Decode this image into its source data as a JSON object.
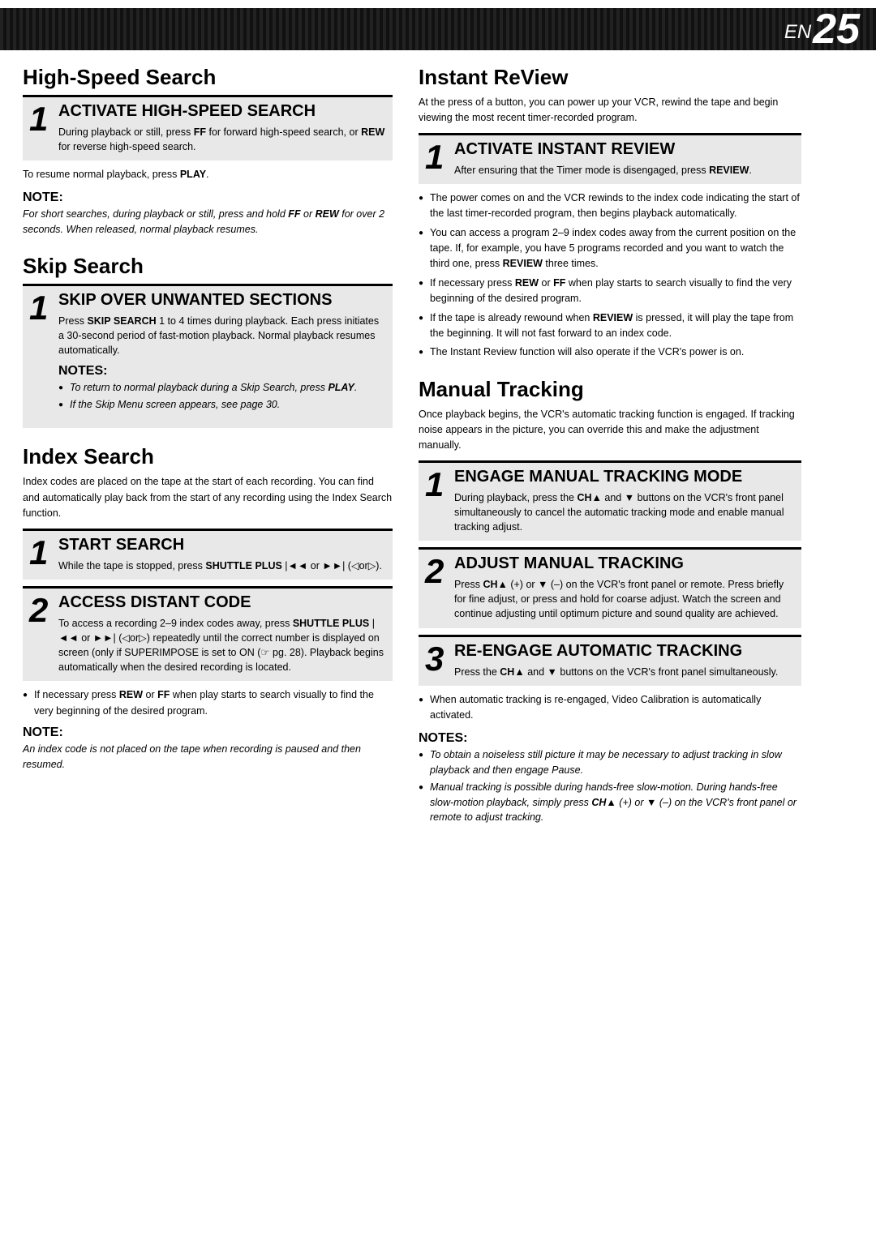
{
  "page": {
    "en_label": "EN",
    "page_number": "25"
  },
  "sections": {
    "high_speed_search": {
      "title": "High-Speed Search",
      "step1": {
        "header": "ACTIVATE HIGH-SPEED SEARCH",
        "body": "During playback or still, press <b>FF</b> for forward high-speed search, or <b>REW</b> for reverse high-speed search."
      },
      "resume": "To resume normal playback, press <b>PLAY</b>.",
      "note": {
        "title": "NOTE:",
        "body": "For short searches, during playback or still, press and hold <b>FF</b> or <b>REW</b> for over 2 seconds. When released, normal playback resumes."
      }
    },
    "skip_search": {
      "title": "Skip Search",
      "step1": {
        "header": "SKIP OVER UNWANTED SECTIONS",
        "body": "Press <b>SKIP SEARCH</b> 1 to 4 times during playback. Each press initiates a 30-second period of fast-motion playback. Normal playback resumes automatically."
      },
      "notes": {
        "title": "NOTES:",
        "items": [
          "To return to normal playback during a Skip Search, press <b>PLAY</b>.",
          "If the Skip Menu screen appears, see page 30."
        ]
      }
    },
    "index_search": {
      "title": "Index Search",
      "intro": "Index codes are placed on the tape at the start of each recording. You can find and automatically play back from the start of any recording using the Index Search function.",
      "step1": {
        "header": "START SEARCH",
        "body": "While the tape is stopped, press <b>SHUTTLE PLUS</b> |◄◄ or ►►| (◁or▷)."
      },
      "step2": {
        "header": "ACCESS DISTANT CODE",
        "body": "To access a recording 2–9 index codes away, press <b>SHUTTLE PLUS</b> |◄◄ or ►►| (◁or▷) repeatedly until the correct number is displayed on screen (only if SUPERIMPOSE is set to ON (☞ pg. 28). Playback begins automatically when the desired recording is located."
      },
      "note_bottom": {
        "title": "NOTE:",
        "body": "An index code is not placed on the tape when recording is paused and then resumed."
      },
      "bullet": "If necessary press <b>REW</b> or <b>FF</b> when play starts to search visually to find the very beginning of the desired program."
    },
    "instant_review": {
      "title": "Instant ReView",
      "intro": "At the press of a button, you can power up your VCR, rewind the tape and begin viewing the most recent timer-recorded program.",
      "step1": {
        "header": "ACTIVATE INSTANT REVIEW",
        "body": "After ensuring that the Timer mode is disengaged, press <b>REVIEW</b>."
      },
      "bullets": [
        "The power comes on and the VCR rewinds to the index code indicating the start of the last timer-recorded program, then begins playback automatically.",
        "You can access a program 2–9 index codes away from the current position on the tape. If, for example, you have 5 programs recorded and you want to watch the third one, press <b>REVIEW</b> three times.",
        "If necessary press <b>REW</b> or <b>FF</b> when play starts to search visually to find the very beginning of the desired program.",
        "If the tape is already rewound when <b>REVIEW</b> is pressed, it will play the tape from the beginning. It will not fast forward to an index code.",
        "The Instant Review function will also operate if the VCR's power is on."
      ]
    },
    "manual_tracking": {
      "title": "Manual Tracking",
      "intro": "Once playback begins, the VCR's automatic tracking function is engaged. If tracking noise appears in the picture, you can override this and make the adjustment manually.",
      "step1": {
        "header": "ENGAGE MANUAL TRACKING MODE",
        "body": "During playback, press the <b>CH▲</b> and <b>▼</b> buttons on the VCR's front panel simultaneously to cancel the automatic tracking mode and enable manual tracking adjust."
      },
      "step2": {
        "header": "ADJUST MANUAL TRACKING",
        "body": "Press <b>CH▲</b> (+) or <b>▼</b> (–) on the VCR's front panel or remote. Press briefly for fine adjust, or press and hold for coarse adjust. Watch the screen and continue adjusting until optimum picture and sound quality are achieved."
      },
      "step3": {
        "header": "RE-ENGAGE AUTOMATIC TRACKING",
        "body": "Press the <b>CH▲</b> and <b>▼</b> buttons on the VCR's front panel simultaneously."
      },
      "bullet_after_step3": "When automatic tracking is re-engaged, Video Calibration is automatically activated.",
      "notes": {
        "title": "NOTES:",
        "items": [
          "To obtain a noiseless still picture it may be necessary to adjust tracking in slow playback and then engage Pause.",
          "Manual tracking is possible during hands-free slow-motion. During hands-free slow-motion playback, simply press <b>CH▲</b> (+) or <b>▼</b> (–) on the VCR's front panel or remote to adjust tracking."
        ]
      }
    }
  }
}
